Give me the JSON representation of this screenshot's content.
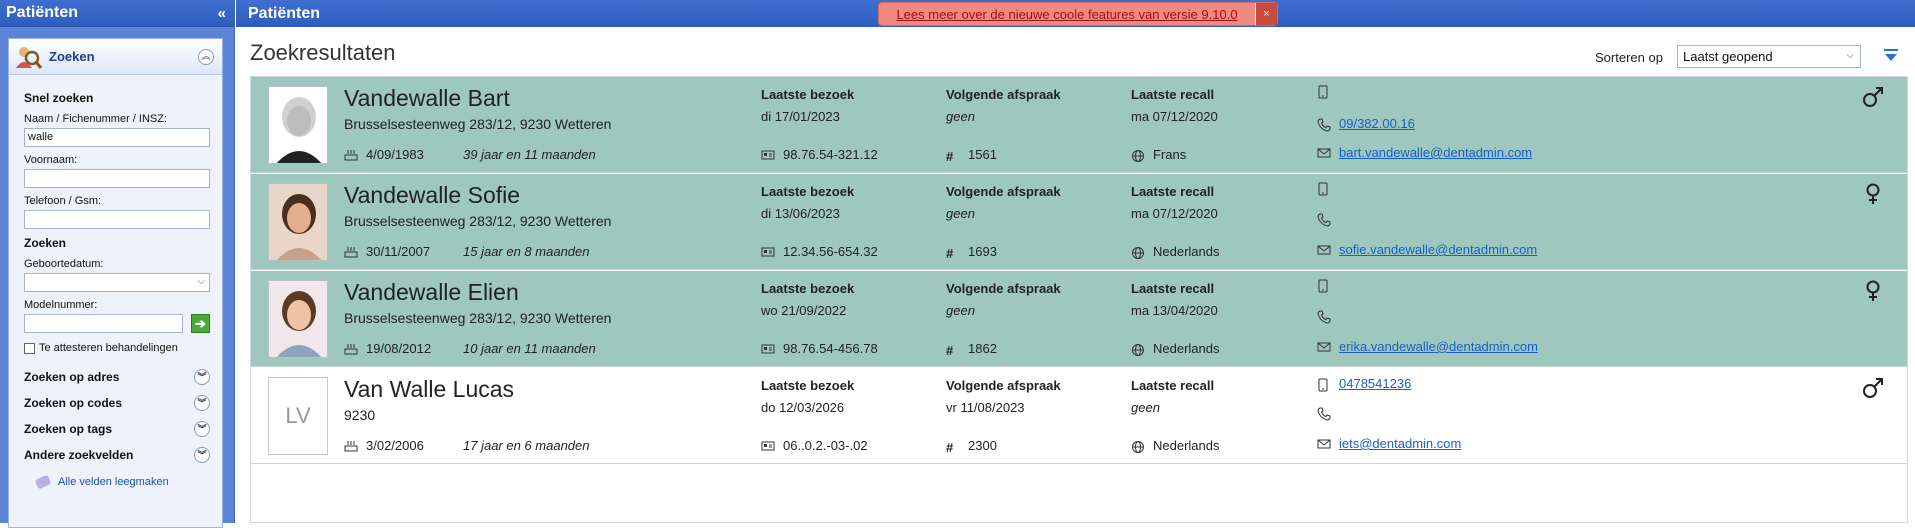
{
  "sidebar": {
    "title": "Patiënten",
    "collapse_icon": "double-chevron-left-icon",
    "panel_title": "Zoeken",
    "quick_search_title": "Snel zoeken",
    "name_label": "Naam / Fichenummer / INSZ:",
    "name_value": "walle",
    "firstname_label": "Voornaam:",
    "firstname_value": "",
    "phone_label": "Telefoon / Gsm:",
    "phone_value": "",
    "search_title": "Zoeken",
    "birthdate_label": "Geboortedatum:",
    "birthdate_value": "",
    "model_label": "Modelnummer:",
    "model_value": "",
    "attest_label": "Te attesteren behandelingen",
    "collapsibles": [
      "Zoeken op adres",
      "Zoeken op codes",
      "Zoeken op tags",
      "Andere zoekvelden"
    ],
    "clear_label": "Alle velden leegmaken"
  },
  "main": {
    "title": "Patiënten",
    "banner_text": "Lees meer over de nieuwe coole features van versie 9.10.0",
    "banner_close": "×",
    "results_title": "Zoekresultaten",
    "sort_label": "Sorteren op",
    "sort_value": "Laatst geopend"
  },
  "labels": {
    "last_visit": "Laatste bezoek",
    "next_appointment": "Volgende afspraak",
    "last_recall": "Laatste recall"
  },
  "patients": [
    {
      "name": "Vandewalle Bart",
      "address": "Brusselsesteenweg 283/12, 9230 Wetteren",
      "birthdate": "4/09/1983",
      "age": "39 jaar en 11 maanden",
      "last_visit": "di 17/01/2023",
      "id_number": "98.76.54-321.12",
      "next_appointment": "geen",
      "file_number": "1561",
      "last_recall": "ma 07/12/2020",
      "language": "Frans",
      "mobile": "",
      "phone": "09/382.00.16",
      "email": "bart.vandewalle@dentadmin.com",
      "gender": "male",
      "selected": true
    },
    {
      "name": "Vandewalle Sofie",
      "address": "Brusselsesteenweg 283/12, 9230 Wetteren",
      "birthdate": "30/11/2007",
      "age": "15 jaar en 8 maanden",
      "last_visit": "di 13/06/2023",
      "id_number": "12.34.56-654.32",
      "next_appointment": "geen",
      "file_number": "1693",
      "last_recall": "ma 07/12/2020",
      "language": "Nederlands",
      "mobile": "",
      "phone": "",
      "email": "sofie.vandewalle@dentadmin.com",
      "gender": "female",
      "selected": true
    },
    {
      "name": "Vandewalle Elien",
      "address": "Brusselsesteenweg 283/12, 9230 Wetteren",
      "birthdate": "19/08/2012",
      "age": "10 jaar en 11 maanden",
      "last_visit": "wo 21/09/2022",
      "id_number": "98.76.54-456.78",
      "next_appointment": "geen",
      "file_number": "1862",
      "last_recall": "ma 13/04/2020",
      "language": "Nederlands",
      "mobile": "",
      "phone": "",
      "email": "erika.vandewalle@dentadmin.com",
      "gender": "female",
      "selected": true
    },
    {
      "name": "Van Walle Lucas",
      "address": "9230",
      "initials": "LV",
      "birthdate": "3/02/2006",
      "age": "17 jaar en 6 maanden",
      "last_visit": "do 12/03/2026",
      "id_number": "06..0.2.-03-.02",
      "next_appointment": "vr 11/08/2023",
      "file_number": "2300",
      "last_recall": "geen",
      "language": "Nederlands",
      "mobile": "0478541236",
      "phone": "",
      "email": "iets@dentadmin.com",
      "gender": "male",
      "selected": false
    }
  ],
  "icons": {
    "birthdate": "cake-icon",
    "id_card": "id-card-icon",
    "file_number": "hash-icon",
    "language": "globe-icon",
    "mobile": "mobile-phone-icon",
    "phone": "phone-icon",
    "email": "envelope-icon"
  },
  "colors": {
    "header_blue": "#2f5dbf",
    "sidebar_blue": "#5b84d6",
    "selected_row": "#9ec7bd",
    "banner": "#f08a80",
    "link": "#1a5fc6"
  }
}
